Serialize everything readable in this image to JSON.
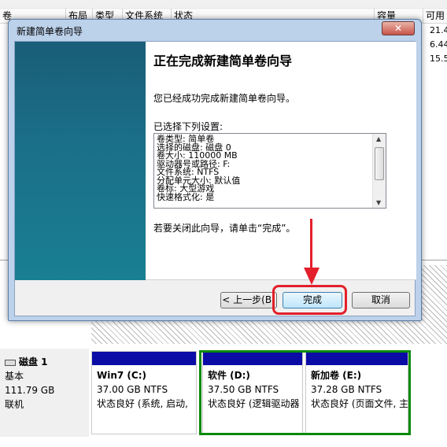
{
  "volume_list": {
    "columns": [
      "卷",
      "布局",
      "类型",
      "文件系统",
      "状态",
      "容量",
      "可用"
    ],
    "free_values": [
      "21.4",
      "6.44",
      "15.5"
    ]
  },
  "disk": {
    "name": "磁盘 1",
    "type": "基本",
    "size": "111.79 GB",
    "status": "联机",
    "partitions": [
      {
        "name": "Win7  (C:)",
        "size": "37.00 GB NTFS",
        "status": "状态良好 (系统, 启动,"
      },
      {
        "name": "软件  (D:)",
        "size": "37.50 GB NTFS",
        "status": "状态良好 (逻辑驱动器"
      },
      {
        "name": "新加卷  (E:)",
        "size": "37.28 GB NTFS",
        "status": "状态良好 (页面文件, 主"
      }
    ]
  },
  "dialog": {
    "title": "新建简单卷向导",
    "close_icon_glyph": "✕",
    "heading": "正在完成新建简单卷向导",
    "success_text": "您已经成功完成新建简单卷向导。",
    "selected_label": "已选择下列设置:",
    "settings": [
      "卷类型: 简单卷",
      "选择的磁盘: 磁盘 0",
      "卷大小: 110000 MB",
      "驱动器号或路径: F:",
      "文件系统: NTFS",
      "分配单元大小: 默认值",
      "卷标: 大型游戏",
      "快速格式化: 是"
    ],
    "close_hint": "若要关闭此向导，请单击“完成”。",
    "back_button": "< 上一步(B)",
    "finish_button": "完成",
    "cancel_button": "取消"
  },
  "colors": {
    "annotation_red": "#e3202b",
    "annotation_green": "#0a8a0a",
    "partition_bar": "#0b0ba6"
  }
}
